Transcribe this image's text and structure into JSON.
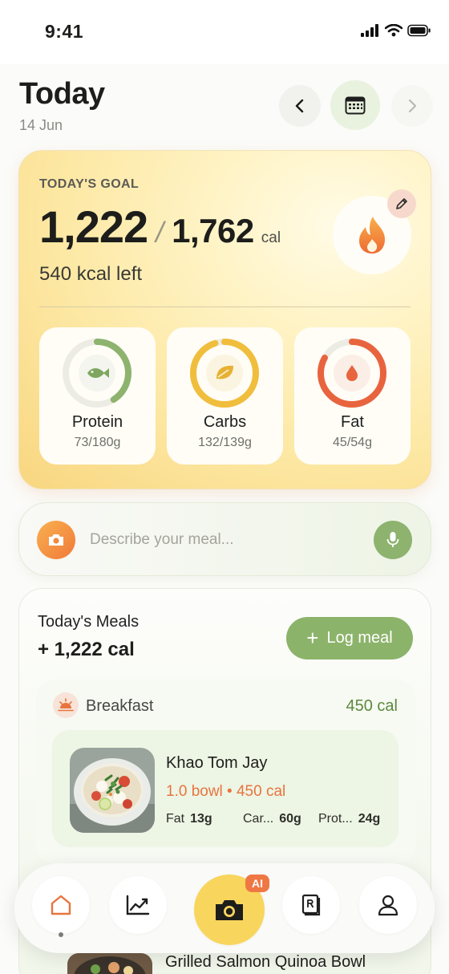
{
  "status": {
    "time": "9:41"
  },
  "header": {
    "title": "Today",
    "date": "14 Jun"
  },
  "goal": {
    "label": "TODAY'S GOAL",
    "consumed": "1,222",
    "slash": "/",
    "target": "1,762",
    "unit": "cal",
    "left": "540 kcal left"
  },
  "macros": [
    {
      "name": "Protein",
      "value": "73/180g",
      "progress": 0.41,
      "color": "#8db36e",
      "icon": "fish-icon"
    },
    {
      "name": "Carbs",
      "value": "132/139g",
      "progress": 0.95,
      "color": "#f0be3c",
      "icon": "leaf-icon"
    },
    {
      "name": "Fat",
      "value": "45/54g",
      "progress": 0.83,
      "color": "#e8643e",
      "icon": "drop-icon"
    }
  ],
  "input": {
    "placeholder": "Describe your meal..."
  },
  "meals": {
    "title": "Today's Meals",
    "total": "+ 1,222 cal",
    "log_label": "Log meal",
    "log_plus": "+",
    "breakfast": {
      "label": "Breakfast",
      "cal": "450 cal",
      "item": {
        "name": "Khao Tom Jay",
        "portion": "1.0 bowl • 450 cal",
        "fat_label": "Fat",
        "fat": "13g",
        "carb_label": "Car...",
        "carb": "60g",
        "protein_label": "Prot...",
        "protein": "24g"
      }
    },
    "next_item": {
      "name": "Grilled Salmon Quinoa Bowl"
    }
  },
  "tabbar": {
    "ai_badge": "AI"
  },
  "colors": {
    "accent_green": "#8cb36a",
    "accent_orange": "#e8743f",
    "camera_yellow": "#f8d55c"
  }
}
